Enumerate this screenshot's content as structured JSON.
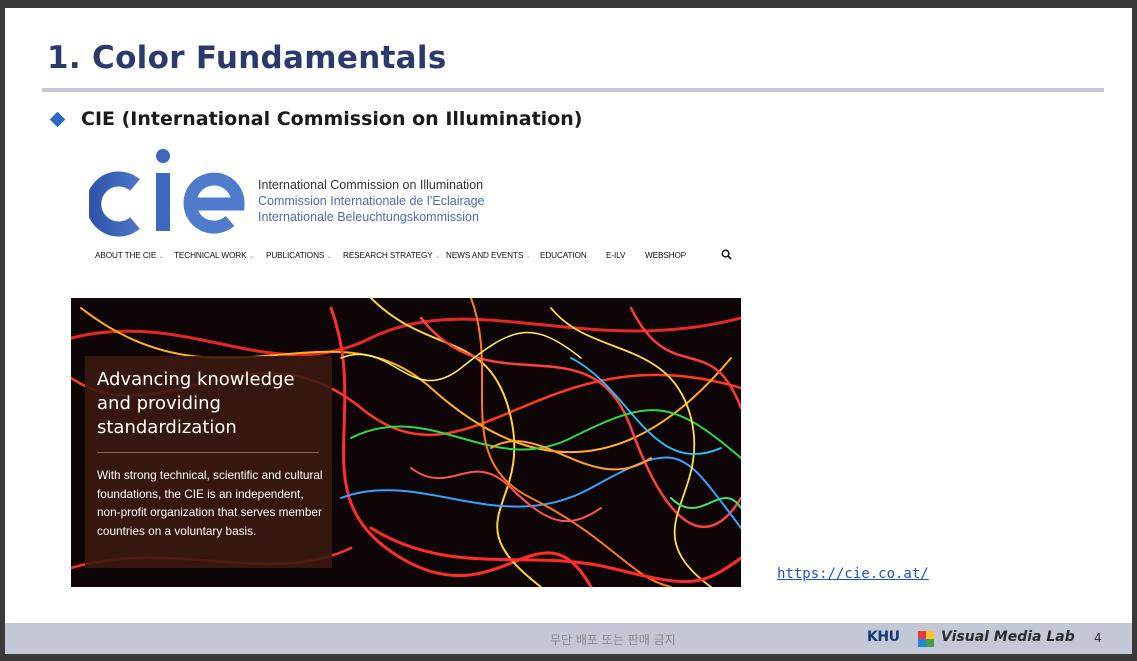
{
  "slide": {
    "title": "1. Color Fundamentals",
    "bullet": "CIE (International Commission on Illumination)",
    "link": "https://cie.co.at/",
    "page_number": "4"
  },
  "cie_site": {
    "logo_text": "cie",
    "names": [
      "International Commission on Illumination",
      "Commission Internationale de l’Eclairage",
      "Internationale Beleuchtungskommission"
    ],
    "nav": [
      {
        "label": "ABOUT THE CIE",
        "dropdown": true
      },
      {
        "label": "TECHNICAL WORK",
        "dropdown": true
      },
      {
        "label": "PUBLICATIONS",
        "dropdown": true
      },
      {
        "label": "RESEARCH STRATEGY",
        "dropdown": true
      },
      {
        "label": "NEWS AND EVENTS",
        "dropdown": true
      },
      {
        "label": "EDUCATION",
        "dropdown": false
      },
      {
        "label": "E-ILV",
        "dropdown": false
      },
      {
        "label": "WEBSHOP",
        "dropdown": false
      }
    ],
    "search_icon": "search-icon",
    "hero": {
      "heading": "Advancing knowledge and providing standardization",
      "body": "With strong technical, scientific and cultural foundations, the CIE is an independent, non-profit organization that serves member countries on a voluntary basis."
    }
  },
  "footer": {
    "notice": "무단 배포 또는 판매 금지",
    "university": "KHU",
    "lab": "Visual Media Lab"
  },
  "colors": {
    "title": "#2b3a6b",
    "accent": "#2f68c4",
    "footer_bg": "#c3c7d6",
    "link": "#1f53c9"
  }
}
